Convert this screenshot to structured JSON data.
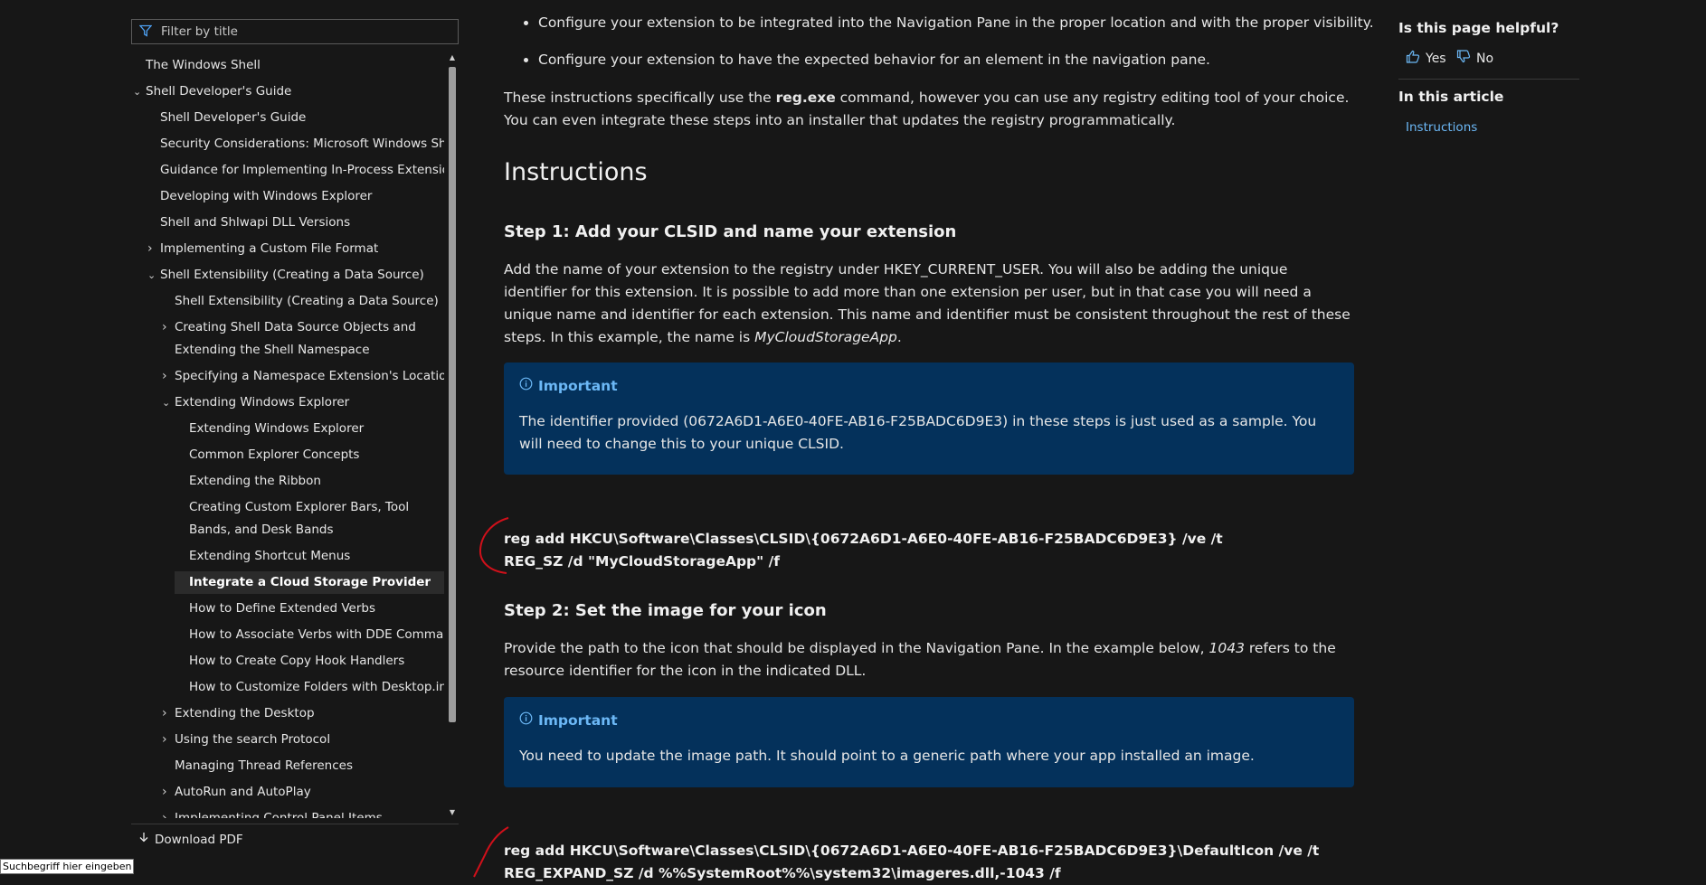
{
  "toc": {
    "filter_placeholder": "Filter by title",
    "items": [
      {
        "label": "The Windows Shell",
        "level": 0,
        "chev": ""
      },
      {
        "label": "Shell Developer's Guide",
        "level": 0,
        "chev": "down"
      },
      {
        "label": "Shell Developer's Guide",
        "level": 1,
        "chev": ""
      },
      {
        "label": "Security Considerations: Microsoft Windows Shell",
        "level": 1,
        "chev": ""
      },
      {
        "label": "Guidance for Implementing In-Process Extensions",
        "level": 1,
        "chev": ""
      },
      {
        "label": "Developing with Windows Explorer",
        "level": 1,
        "chev": ""
      },
      {
        "label": "Shell and Shlwapi DLL Versions",
        "level": 1,
        "chev": ""
      },
      {
        "label": "Implementing a Custom File Format",
        "level": 1,
        "chev": "right"
      },
      {
        "label": "Shell Extensibility (Creating a Data Source)",
        "level": 1,
        "chev": "down"
      },
      {
        "label": "Shell Extensibility (Creating a Data Source)",
        "level": 2,
        "chev": ""
      },
      {
        "label": "Creating Shell Data Source Objects and Extending the Shell Namespace",
        "level": 2,
        "chev": "right",
        "wrap": true
      },
      {
        "label": "Specifying a Namespace Extension's Location",
        "level": 2,
        "chev": "right"
      },
      {
        "label": "Extending Windows Explorer",
        "level": 2,
        "chev": "down"
      },
      {
        "label": "Extending Windows Explorer",
        "level": 3,
        "chev": ""
      },
      {
        "label": "Common Explorer Concepts",
        "level": 3,
        "chev": ""
      },
      {
        "label": "Extending the Ribbon",
        "level": 3,
        "chev": ""
      },
      {
        "label": "Creating Custom Explorer Bars, Tool Bands, and Desk Bands",
        "level": 3,
        "chev": "",
        "wrap": true
      },
      {
        "label": "Extending Shortcut Menus",
        "level": 3,
        "chev": ""
      },
      {
        "label": "Integrate a Cloud Storage Provider",
        "level": 3,
        "chev": "",
        "active": true
      },
      {
        "label": "How to Define Extended Verbs",
        "level": 3,
        "chev": ""
      },
      {
        "label": "How to Associate Verbs with DDE Commands",
        "level": 3,
        "chev": ""
      },
      {
        "label": "How to Create Copy Hook Handlers",
        "level": 3,
        "chev": ""
      },
      {
        "label": "How to Customize Folders with Desktop.ini",
        "level": 3,
        "chev": ""
      },
      {
        "label": "Extending the Desktop",
        "level": 2,
        "chev": "right"
      },
      {
        "label": "Using the search Protocol",
        "level": 2,
        "chev": "right"
      },
      {
        "label": "Managing Thread References",
        "level": 2,
        "chev": ""
      },
      {
        "label": "AutoRun and AutoPlay",
        "level": 2,
        "chev": "right"
      },
      {
        "label": "Implementing Control Panel Items",
        "level": 2,
        "chev": "right"
      }
    ],
    "download_label": "Download PDF"
  },
  "tooltip": "Suchbegriff hier eingeben",
  "main": {
    "bullets": [
      "Configure your extension to be integrated into the Navigation Pane in the proper location and with the proper visibility.",
      "Configure your extension to have the expected behavior for an element in the navigation pane."
    ],
    "intro_before": "These instructions specifically use the ",
    "intro_bold": "reg.exe",
    "intro_after": " command, however you can use any registry editing tool of your choice. You can even integrate these steps into an installer that updates the registry programmatically.",
    "heading": "Instructions",
    "step1_title": "Step 1: Add your CLSID and name your extension",
    "step1_text": "Add the name of your extension to the registry under HKEY_CURRENT_USER. You will also be adding the unique identifier for this extension. It is possible to add more than one extension per user, but in that case you will need a unique name and identifier for each extension. This name and identifier must be consistent throughout the rest of these steps. In this example, the name is ",
    "step1_example": "MyCloudStorageApp",
    "step1_end": ".",
    "alert1_title": "Important",
    "alert1_text": "The identifier provided (0672A6D1-A6E0-40FE-AB16-F25BADC6D9E3) in these steps is just used as a sample. You will need to change this to your unique CLSID.",
    "code1": "reg add HKCU\\Software\\Classes\\CLSID\\{0672A6D1-A6E0-40FE-AB16-F25BADC6D9E3} /ve /t REG_SZ /d \"MyCloudStorageApp\" /f",
    "step2_title": "Step 2: Set the image for your icon",
    "step2_before": "Provide the path to the icon that should be displayed in the Navigation Pane. In the example below, ",
    "step2_em": "1043",
    "step2_after": " refers to the resource identifier for the icon in the indicated DLL.",
    "alert2_title": "Important",
    "alert2_text": "You need to update the image path. It should point to a generic path where your app installed an image.",
    "code2": "reg add HKCU\\Software\\Classes\\CLSID\\{0672A6D1-A6E0-40FE-AB16-F25BADC6D9E3}\\DefaultIcon /ve /t REG_EXPAND_SZ /d %%SystemRoot%%\\system32\\imageres.dll,-1043 /f"
  },
  "rail": {
    "helpful_question": "Is this page helpful?",
    "yes_label": "Yes",
    "no_label": "No",
    "in_this_article": "In this article",
    "links": [
      "Instructions"
    ]
  },
  "colors": {
    "background": "#171717",
    "alert_background": "#04315b",
    "link": "#6cb8f6",
    "annotation_marker": "#d0101a"
  },
  "icons": [
    "filter-icon",
    "chevron-down-icon",
    "chevron-right-icon",
    "download-icon",
    "info-icon",
    "thumbs-up-icon",
    "thumbs-down-icon"
  ]
}
